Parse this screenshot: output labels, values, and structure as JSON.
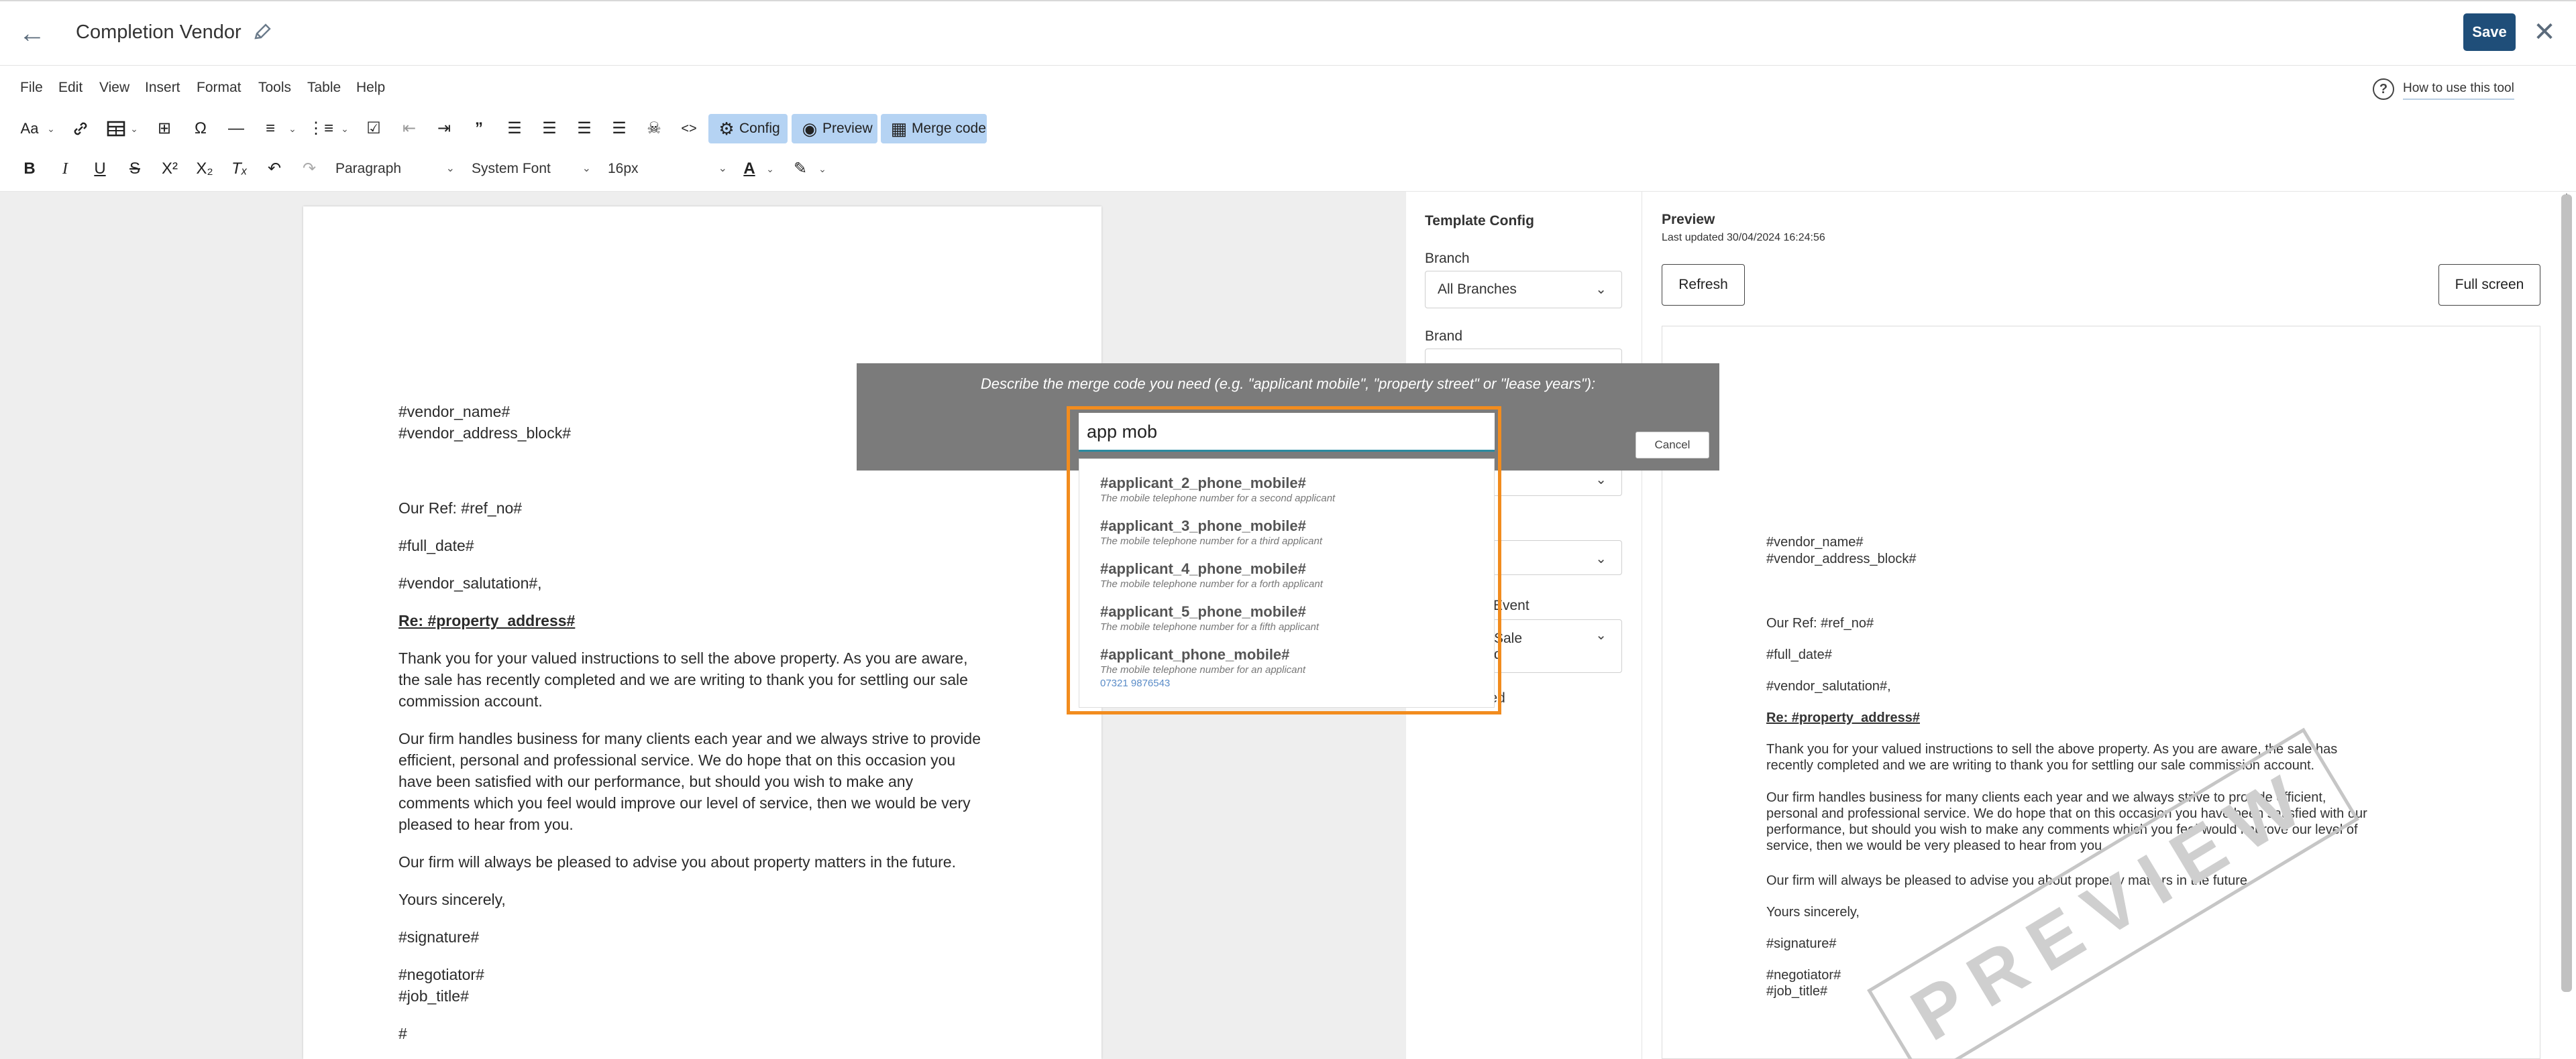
{
  "header": {
    "title": "Completion Vendor",
    "save_label": "Save"
  },
  "menu": [
    "File",
    "Edit",
    "View",
    "Insert",
    "Format",
    "Tools",
    "Table",
    "Help"
  ],
  "help": {
    "link_label": "How to use this tool"
  },
  "toolbar": {
    "config_label": "Config",
    "preview_label": "Preview",
    "merge_code_label": "Merge code",
    "block_format": "Paragraph",
    "font_family": "System Font",
    "font_size": "16px"
  },
  "editor": {
    "lines": {
      "vendor_name": "#vendor_name#",
      "vendor_address": "#vendor_address_block#",
      "ref": "Our Ref: #ref_no#",
      "date": "#full_date#",
      "salutation": "#vendor_salutation#,",
      "re": "Re: #property_address#",
      "p1a": "Thank you for your valued instructions to sell the above property. As you are aware,",
      "p1b": "the sale has recently completed and we are writing to thank you for settling our sale",
      "p1c": "commission account.",
      "p2a": "Our firm handles business for many clients each year and we always strive to provide",
      "p2b": "efficient, personal and professional service. We do hope that on this occasion you",
      "p2c": "have been satisfied with our performance, but should you wish to make any",
      "p2d": "comments which you feel would improve our level of service, then we would be very",
      "p2e": "pleased to hear from you.",
      "p3": "Our firm will always be pleased to advise you about property matters in the future.",
      "closing": "Yours sincerely,",
      "signature": "#signature#",
      "negotiator": "#negotiator#",
      "job_title": "#job_title#",
      "hash": "#"
    }
  },
  "config": {
    "title": "Template Config",
    "branch_label": "Branch",
    "branch_value": "All Branches",
    "brand_label": "Brand",
    "partial_t": "t",
    "partial_event": "Event",
    "partial_sale": "Sale",
    "partial_d": "d",
    "partial_locked": "ked"
  },
  "preview": {
    "title": "Preview",
    "updated": "Last updated 30/04/2024 16:24:56",
    "refresh_label": "Refresh",
    "fullscreen_label": "Full screen",
    "watermark": "PREVIEW",
    "lines": {
      "vendor_name": "#vendor_name#",
      "vendor_address": "#vendor_address_block#",
      "ref": "Our Ref: #ref_no#",
      "date": "#full_date#",
      "salutation": "#vendor_salutation#,",
      "re": "Re: #property_address#",
      "p1a": "Thank you for your valued instructions to sell the above property. As you are aware, the sale has",
      "p1b": "recently completed and we are writing to thank you for settling our sale commission account.",
      "p2a": "Our firm handles business for many clients each year and we always strive to provide efficient,",
      "p2b": "personal and professional service. We do hope that on this occasion you have been satisfied with our",
      "p2c": "performance, but should you wish to make any comments which you feel would improve our level of",
      "p2d": "service, then we would be very pleased to hear from you.",
      "p3": "Our firm will always be pleased to advise you about property matters in the future.",
      "closing": "Yours sincerely,",
      "signature": "#signature#",
      "negotiator": "#negotiator#",
      "job_title": "#job_title#"
    }
  },
  "merge_dialog": {
    "prompt": "Describe the merge code you need (e.g. \"applicant mobile\", \"property street\" or \"lease years\"):",
    "query": "app mob",
    "cancel_label": "Cancel",
    "options": [
      {
        "code": "#applicant_2_phone_mobile#",
        "desc": "The mobile telephone number for a second applicant"
      },
      {
        "code": "#applicant_3_phone_mobile#",
        "desc": "The mobile telephone number for a third applicant"
      },
      {
        "code": "#applicant_4_phone_mobile#",
        "desc": "The mobile telephone number for a forth applicant"
      },
      {
        "code": "#applicant_5_phone_mobile#",
        "desc": "The mobile telephone number for a fifth applicant"
      },
      {
        "code": "#applicant_phone_mobile#",
        "desc": "The mobile telephone number for an applicant",
        "sample": "07321 9876543"
      }
    ]
  },
  "icons": {
    "back": "arrow-left-icon",
    "edit": "pencil-icon",
    "close": "x-icon",
    "help": "question-circle-icon"
  }
}
